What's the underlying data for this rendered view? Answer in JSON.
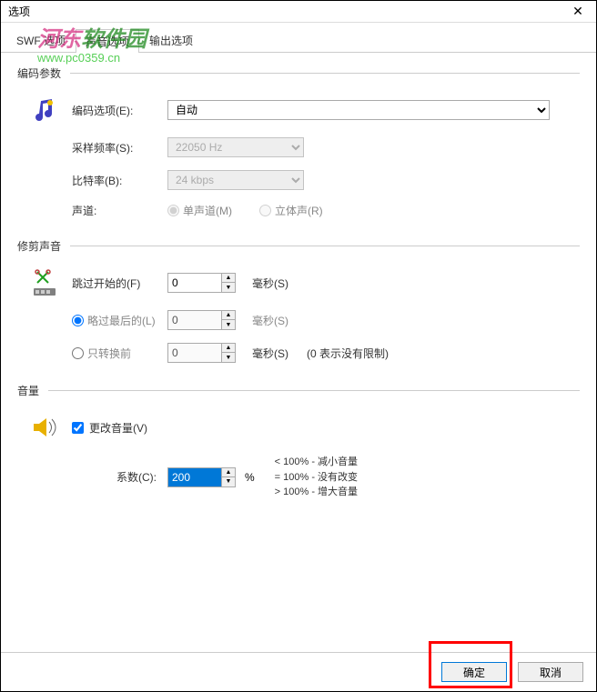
{
  "window": {
    "title": "选项"
  },
  "tabs": {
    "items": [
      "SWF 选项",
      "声音选项",
      "输出选项"
    ],
    "active": 1
  },
  "encoding": {
    "title": "编码参数",
    "option_label": "编码选项(E):",
    "option_value": "自动",
    "rate_label": "采样频率(S):",
    "rate_value": "22050 Hz",
    "bitrate_label": "比特率(B):",
    "bitrate_value": "24 kbps",
    "channel_label": "声道:",
    "mono_label": "单声道(M)",
    "stereo_label": "立体声(R)"
  },
  "trim": {
    "title": "修剪声音",
    "skip_start_label": "跳过开始的(F)",
    "skip_start_value": "0",
    "skip_end_label": "略过最后的(L)",
    "skip_end_value": "0",
    "convert_only_label": "只转换前",
    "convert_only_value": "0",
    "unit_ms": "毫秒(S)",
    "limit_hint": "(0 表示没有限制)"
  },
  "volume": {
    "title": "音量",
    "change_label": "更改音量(V)",
    "coef_label": "系数(C):",
    "coef_value": "200",
    "percent": "%",
    "hint1": "< 100% - 减小音量",
    "hint2": "= 100% - 没有改变",
    "hint3": "> 100% - 增大音量"
  },
  "footer": {
    "ok": "确定",
    "cancel": "取消"
  },
  "watermark": {
    "t1": "河东",
    "t2": "软件园",
    "url": "www.pc0359.cn"
  }
}
